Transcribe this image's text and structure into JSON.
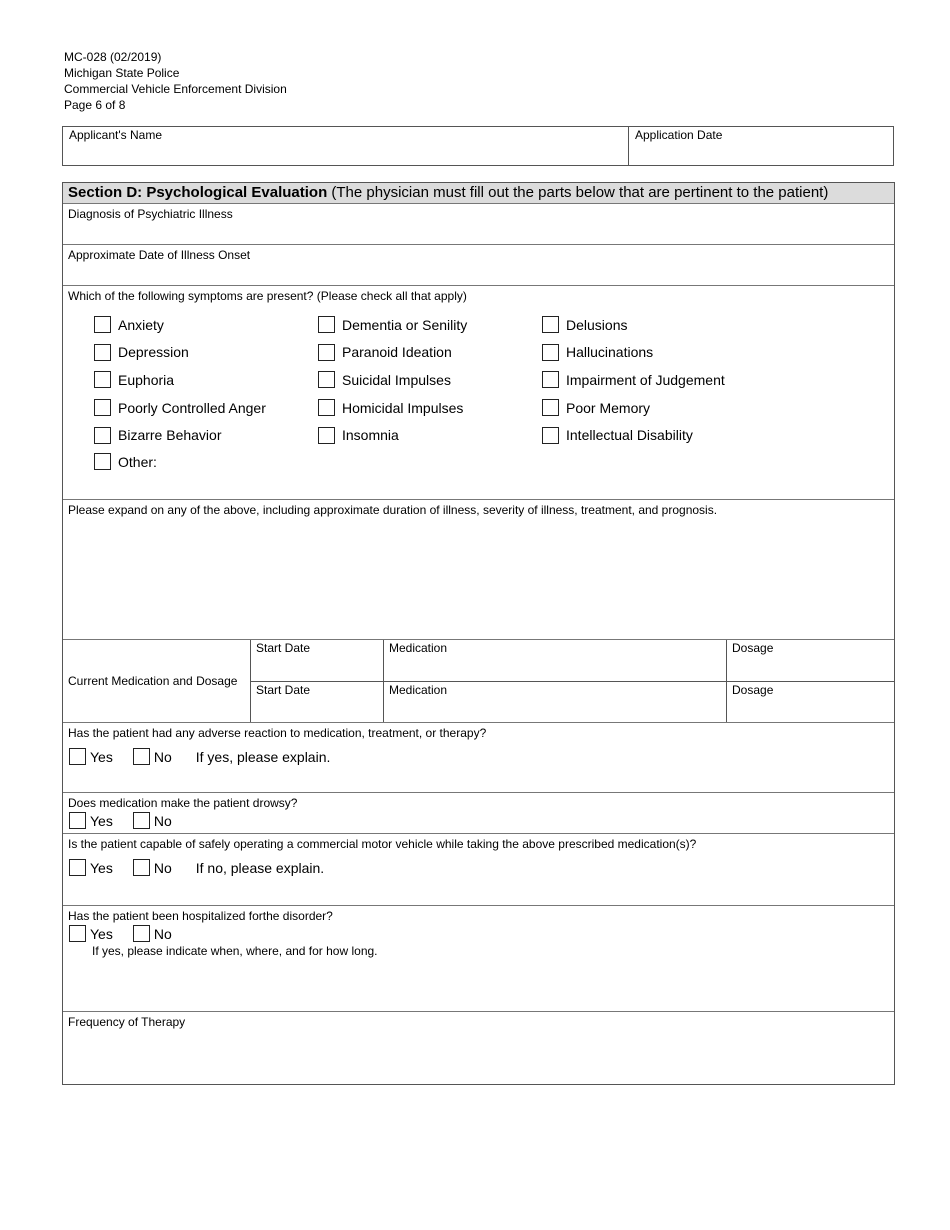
{
  "doc_header": {
    "form_number": "MC-028 (02/2019)",
    "agency": "Michigan State Police",
    "division": "Commercial Vehicle Enforcement Division",
    "page": "Page 6 of 8"
  },
  "applicant": {
    "name_label": "Applicant's Name",
    "name_value": "",
    "date_label": "Application Date",
    "date_value": ""
  },
  "section": {
    "title": "Section D: Psychological Evaluation",
    "subtitle": " (The physician must fill out the parts below that are pertinent to the patient)"
  },
  "fields": {
    "diagnosis_label": "Diagnosis of Psychiatric Illness",
    "onset_label": "Approximate Date of Illness Onset",
    "symptoms_question": "Which of the following symptoms are present? (Please check all that apply)",
    "expand_label": "Please expand on any of the above, including approximate duration of illness, severity of illness, treatment, and prognosis.",
    "frequency_label": "Frequency of Therapy"
  },
  "symptoms": {
    "col1": [
      {
        "label": "Anxiety",
        "checked": false
      },
      {
        "label": "Depression",
        "checked": false
      },
      {
        "label": "Euphoria",
        "checked": false
      },
      {
        "label": "Poorly Controlled Anger",
        "checked": false
      },
      {
        "label": "Bizarre Behavior",
        "checked": false
      }
    ],
    "col2": [
      {
        "label": "Dementia or Senility",
        "checked": false
      },
      {
        "label": "Paranoid Ideation",
        "checked": false
      },
      {
        "label": "Suicidal Impulses",
        "checked": false
      },
      {
        "label": "Homicidal Impulses",
        "checked": false
      },
      {
        "label": "Insomnia",
        "checked": false
      }
    ],
    "col3": [
      {
        "label": "Delusions",
        "checked": false
      },
      {
        "label": "Hallucinations",
        "checked": false
      },
      {
        "label": "Impairment of Judgement",
        "checked": false
      },
      {
        "label": "Poor Memory",
        "checked": false
      },
      {
        "label": "Intellectual Disability",
        "checked": false
      }
    ],
    "other": {
      "label": "Other:",
      "checked": false
    }
  },
  "medication": {
    "label": "Current Medication and Dosage",
    "rows": [
      {
        "start_date": "Start Date",
        "medication": "Medication",
        "dosage": "Dosage"
      },
      {
        "start_date": "Start Date",
        "medication": "Medication",
        "dosage": "Dosage"
      }
    ]
  },
  "questions": {
    "adverse": {
      "question": "Has the patient had any adverse reaction to medication, treatment, or therapy?",
      "yes": "Yes",
      "no": "No",
      "note": "If yes, please explain."
    },
    "drowsy": {
      "question": "Does medication make the patient drowsy?",
      "yes": "Yes",
      "no": "No"
    },
    "capable": {
      "question": "Is the patient capable of safely operating a commercial motor vehicle while taking the above prescribed medication(s)?",
      "yes": "Yes",
      "no": "No",
      "note": "If no, please explain."
    },
    "hospitalized": {
      "question": "Has the patient been hospitalized forthe disorder?",
      "yes": "Yes",
      "no": "No",
      "note": "If yes, please indicate when, where, and for how long."
    }
  }
}
